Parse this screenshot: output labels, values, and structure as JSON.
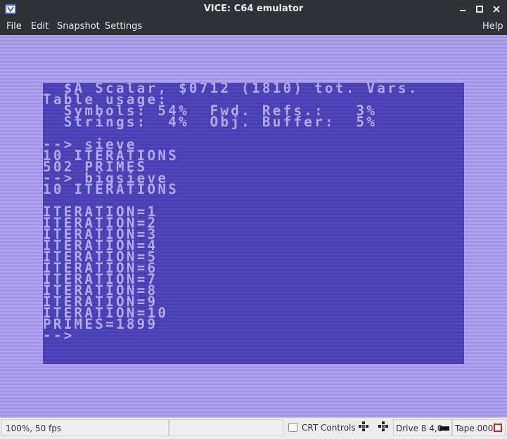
{
  "window": {
    "title": "VICE: C64 emulator"
  },
  "icons": {
    "app": "vice-app-icon",
    "minimize": "minimize-icon",
    "maximize": "maximize-icon",
    "close": "close-icon",
    "joystick1": "joystick-port-icon",
    "joystick2": "joystick-port-icon",
    "drive_led": "drive-led-icon",
    "tape_led": "tape-led-icon"
  },
  "menu": {
    "file": "File",
    "edit": "Edit",
    "snapshot": "Snapshot",
    "settings": "Settings",
    "help": "Help"
  },
  "colors": {
    "border": "#a99bea",
    "screen": "#4d43b8",
    "text": "#b4aaf0",
    "tape_led": "#e01b1b"
  },
  "screen": {
    "lines": [
      "  $A Scalar, $0712 (1810) tot. Vars.",
      "Table usage:",
      "  Symbols: 54%  Fwd. Refs.:   3%",
      "  Strings:  4%  Obj. Buffer:  5%",
      "",
      "--> sieve",
      "10 ITERATIONS",
      "502 PRIMES",
      "--> bigsieve",
      "10 ITERATIONS",
      "",
      "ITERATION=1",
      "ITERATION=2",
      "ITERATION=3",
      "ITERATION=4",
      "ITERATION=5",
      "ITERATION=6",
      "ITERATION=7",
      "ITERATION=8",
      "ITERATION=9",
      "ITERATION=10",
      "PRIMES=1899",
      "-->"
    ]
  },
  "status": {
    "speed": "100%, 50 fps",
    "crt_label": "CRT Controls",
    "drive": "Drive 8 4,0",
    "tape": "Tape 000"
  }
}
